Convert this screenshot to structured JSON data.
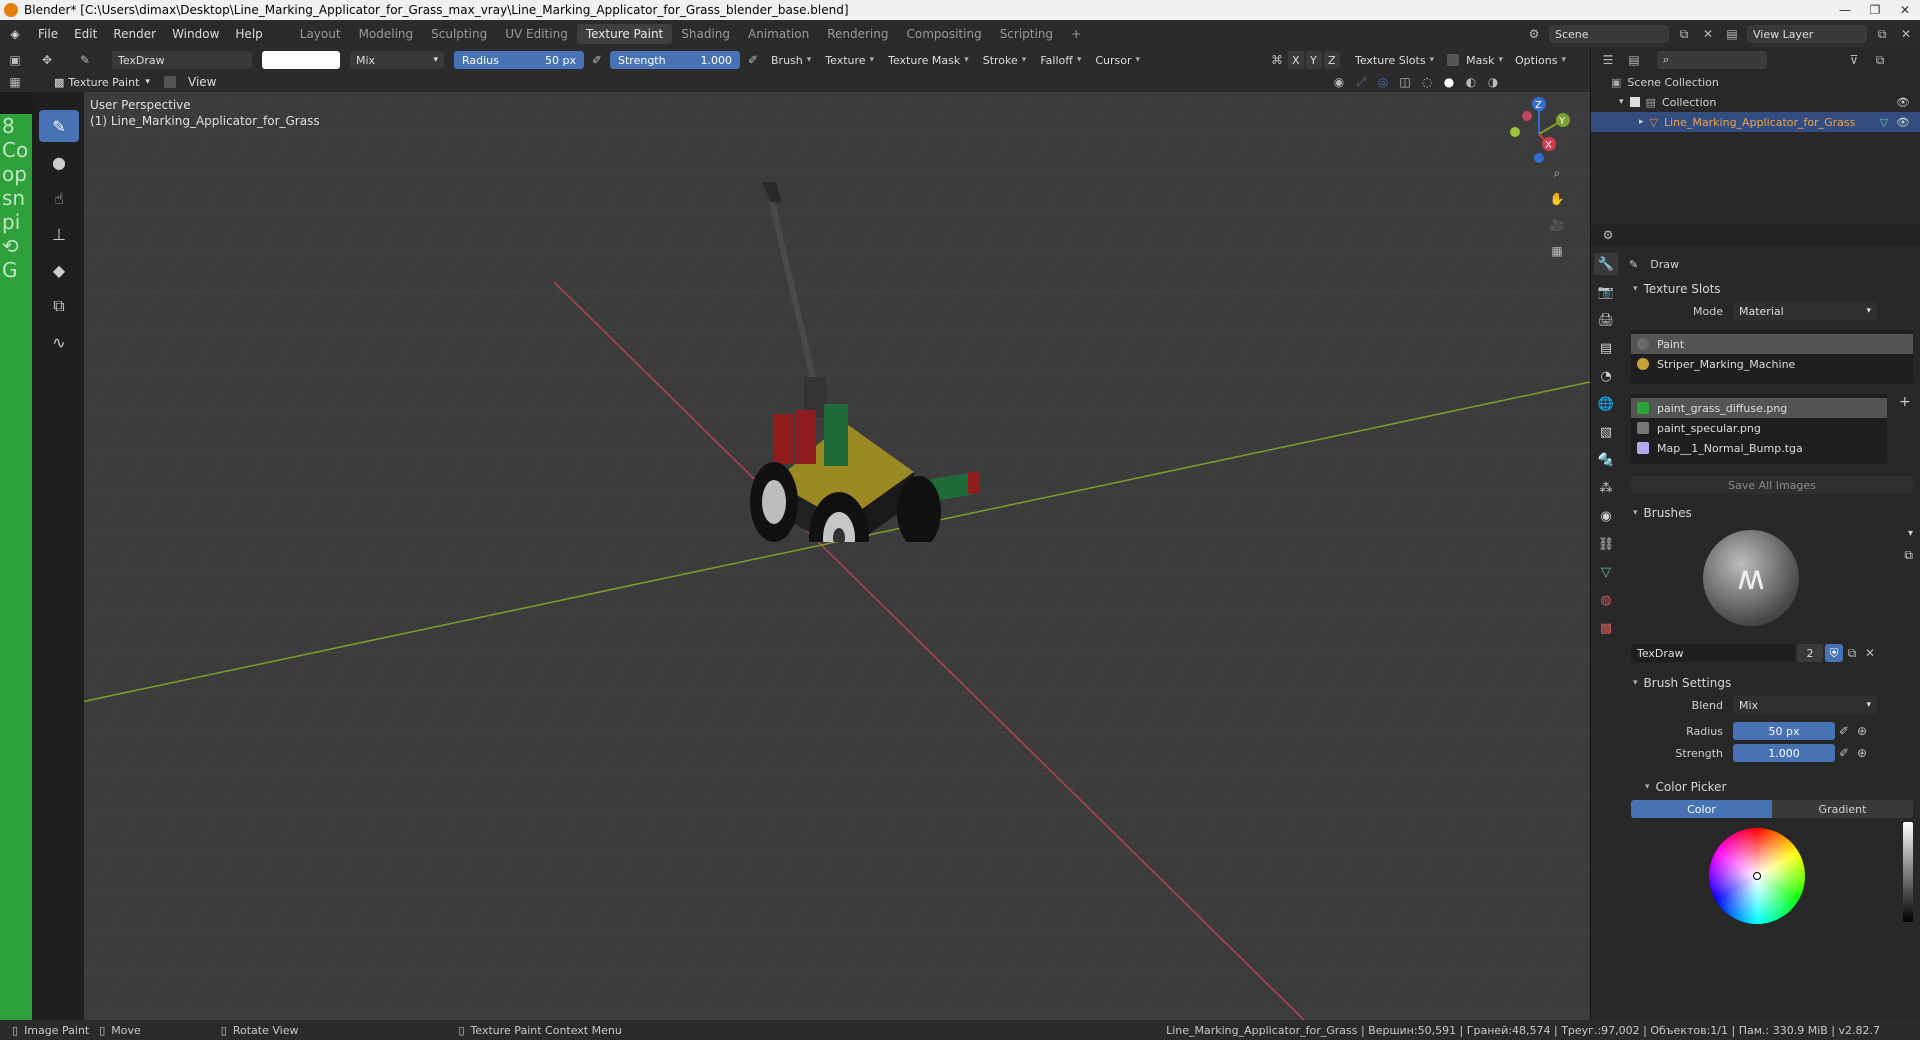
{
  "window": {
    "title": "Blender* [C:\\Users\\dimax\\Desktop\\Line_Marking_Applicator_for_Grass_max_vray\\Line_Marking_Applicator_for_Grass_blender_base.blend]"
  },
  "menu": [
    "File",
    "Edit",
    "Render",
    "Window",
    "Help"
  ],
  "workspaces": [
    "Layout",
    "Modeling",
    "Sculpting",
    "UV Editing",
    "Texture Paint",
    "Shading",
    "Animation",
    "Rendering",
    "Compositing",
    "Scripting"
  ],
  "active_workspace": "Texture Paint",
  "scene": {
    "label": "Scene",
    "view_layer": "View Layer"
  },
  "tool_header": {
    "brush_name": "TexDraw",
    "blend": "Mix",
    "radius_label": "Radius",
    "radius_value": "50 px",
    "strength_label": "Strength",
    "strength_value": "1.000",
    "menus": [
      "Brush",
      "Texture",
      "Texture Mask",
      "Stroke",
      "Falloff",
      "Cursor"
    ],
    "axes": [
      "X",
      "Y",
      "Z"
    ],
    "right_menus": [
      "Texture Slots",
      "Mask",
      "Options"
    ]
  },
  "header2": {
    "mode": "Texture Paint",
    "view": "View"
  },
  "viewport": {
    "perspective": "User Perspective",
    "object": "(1) Line_Marking_Applicator_for_Grass",
    "gizmo_axes": [
      "Z",
      "Y",
      "X"
    ]
  },
  "outliner": {
    "root": "Scene Collection",
    "collection": "Collection",
    "object": "Line_Marking_Applicator_for_Grass"
  },
  "properties": {
    "tool": "Draw",
    "texture_slots": {
      "title": "Texture Slots",
      "mode_label": "Mode",
      "mode_value": "Material",
      "materials": [
        "Paint",
        "Striper_Marking_Machine"
      ],
      "images": [
        "paint_grass_diffuse.png",
        "paint_specular.png",
        "Map__1_Normal_Bump.tga"
      ],
      "save_all": "Save All Images"
    },
    "brushes": {
      "title": "Brushes",
      "name": "TexDraw",
      "users": "2"
    },
    "brush_settings": {
      "title": "Brush Settings",
      "blend_label": "Blend",
      "blend_value": "Mix",
      "radius_label": "Radius",
      "radius_value": "50 px",
      "strength_label": "Strength",
      "strength_value": "1.000"
    },
    "color_picker": {
      "title": "Color Picker",
      "tabs": [
        "Color",
        "Gradient"
      ]
    }
  },
  "status": {
    "items": [
      "Image Paint",
      "Move",
      "Rotate View",
      "Texture Paint Context Menu"
    ],
    "stats": "Line_Marking_Applicator_for_Grass | Вершин:50,591 | Граней:48,574 | Треуг.:97,002 | Объектов:1/1 | Пам.: 330.9 MiB | v2.82.7"
  },
  "colors": {
    "accent": "#4772b3",
    "grid": "#3c3c3c",
    "x_axis": "#b3454f",
    "y_axis": "#7ba02d"
  }
}
